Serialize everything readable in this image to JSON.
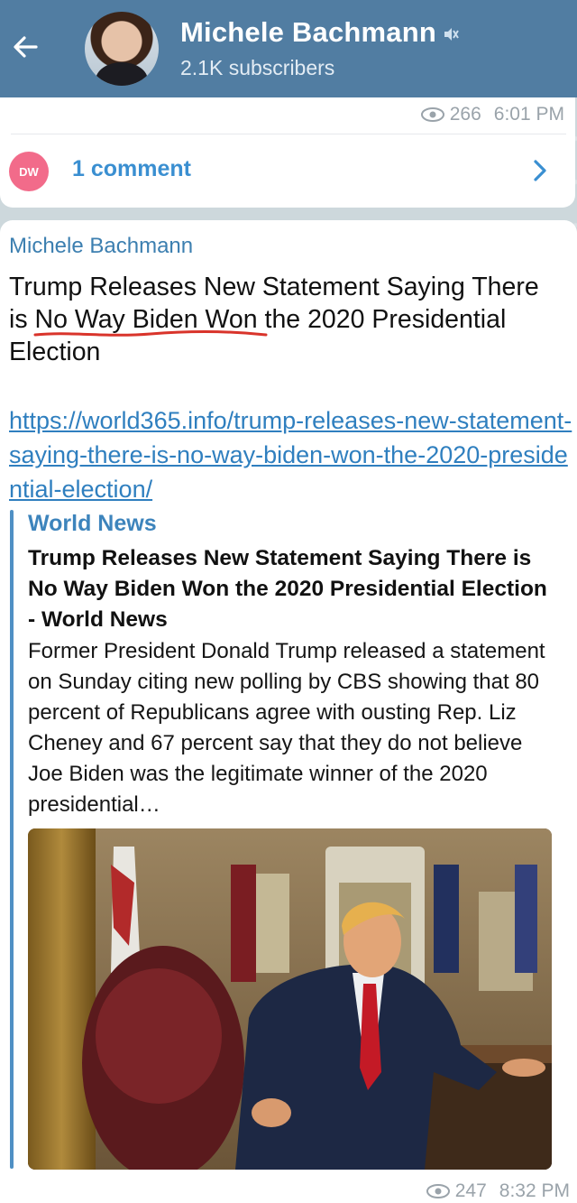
{
  "header": {
    "channel_name": "Michele Bachmann",
    "subscribers": "2.1K subscribers"
  },
  "post1": {
    "views": "266",
    "time": "6:01 PM",
    "commenter_initials": "DW",
    "comments_label": "1 comment"
  },
  "post2": {
    "author": "Michele Bachmann",
    "text_before": "Trump Releases New Statement Saying There is ",
    "text_highlight": "No Way Biden Won",
    "text_after": " the 2020 Presidential Election",
    "link": "https://world365.info/trump-releases-new-statement-saying-there-is-no-way-biden-won-the-2020-presidential-election/",
    "preview": {
      "site": "World News",
      "title": "Trump Releases New Statement Saying There is No Way Biden Won the 2020 Presidential Election - World News",
      "description": "Former President Donald Trump released a statement on Sunday citing new polling by CBS showing that 80 percent of Republicans agree with ousting Rep. Liz Cheney and 67 percent say that they do not believe Joe Biden was the legitimate winner of the 2020 presidential…"
    },
    "views": "247",
    "time": "8:32 PM"
  },
  "icons": {
    "back": "arrow-left-icon",
    "mute": "muted-speaker-icon",
    "views": "eye-icon",
    "chevron": "chevron-right-icon"
  },
  "colors": {
    "header_bg": "#517da2",
    "link": "#2f7fbf",
    "accent": "#3a8fd1",
    "badge": "#f26b8a",
    "underline": "#d9342b"
  }
}
